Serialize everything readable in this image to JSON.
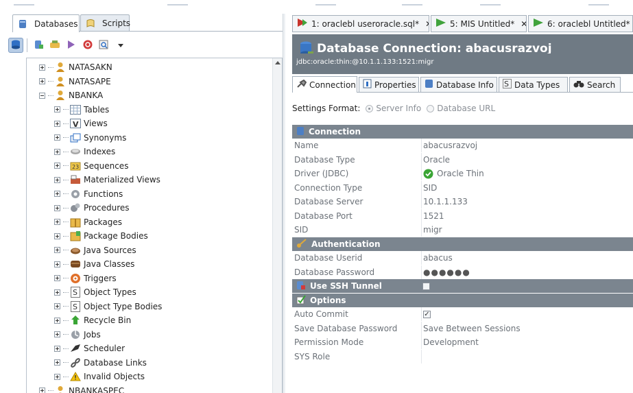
{
  "left_tabs": [
    {
      "label": "Databases",
      "active": true
    },
    {
      "label": "Scripts",
      "active": false
    }
  ],
  "tree": [
    {
      "label": "NATASAKN",
      "level": 0,
      "icon": "user-icon",
      "expanded": false
    },
    {
      "label": "NATASAPE",
      "level": 0,
      "icon": "user-icon",
      "expanded": false
    },
    {
      "label": "NBANKA",
      "level": 0,
      "icon": "user-icon",
      "expanded": true
    },
    {
      "label": "Tables",
      "level": 1,
      "icon": "tables-icon",
      "expanded": false
    },
    {
      "label": "Views",
      "level": 1,
      "icon": "views-icon",
      "expanded": false
    },
    {
      "label": "Synonyms",
      "level": 1,
      "icon": "synonyms-icon",
      "expanded": false
    },
    {
      "label": "Indexes",
      "level": 1,
      "icon": "indexes-icon",
      "expanded": false
    },
    {
      "label": "Sequences",
      "level": 1,
      "icon": "sequences-icon",
      "expanded": false
    },
    {
      "label": "Materialized Views",
      "level": 1,
      "icon": "materialized-views-icon",
      "expanded": false
    },
    {
      "label": "Functions",
      "level": 1,
      "icon": "functions-icon",
      "expanded": false
    },
    {
      "label": "Procedures",
      "level": 1,
      "icon": "procedures-icon",
      "expanded": false
    },
    {
      "label": "Packages",
      "level": 1,
      "icon": "packages-icon",
      "expanded": false
    },
    {
      "label": "Package Bodies",
      "level": 1,
      "icon": "package-bodies-icon",
      "expanded": false
    },
    {
      "label": "Java Sources",
      "level": 1,
      "icon": "java-sources-icon",
      "expanded": false
    },
    {
      "label": "Java Classes",
      "level": 1,
      "icon": "java-classes-icon",
      "expanded": false
    },
    {
      "label": "Triggers",
      "level": 1,
      "icon": "triggers-icon",
      "expanded": false
    },
    {
      "label": "Object Types",
      "level": 1,
      "icon": "object-types-icon",
      "expanded": false
    },
    {
      "label": "Object Type Bodies",
      "level": 1,
      "icon": "object-type-bodies-icon",
      "expanded": false
    },
    {
      "label": "Recycle Bin",
      "level": 1,
      "icon": "recycle-bin-icon",
      "expanded": false
    },
    {
      "label": "Jobs",
      "level": 1,
      "icon": "jobs-icon",
      "expanded": false
    },
    {
      "label": "Scheduler",
      "level": 1,
      "icon": "scheduler-icon",
      "expanded": false
    },
    {
      "label": "Database Links",
      "level": 1,
      "icon": "database-links-icon",
      "expanded": false
    },
    {
      "label": "Invalid Objects",
      "level": 1,
      "icon": "invalid-objects-icon",
      "expanded": false
    },
    {
      "label": "NBANKASPEC",
      "level": 0,
      "icon": "user-icon",
      "expanded": false
    }
  ],
  "editor_tabs": [
    {
      "label": "1: oraclebl useroracle.sql*",
      "closable": true
    },
    {
      "label": "5: MIS Untitled*",
      "closable": true
    },
    {
      "label": "6: oraclebl Untitled*",
      "closable": false
    }
  ],
  "connection": {
    "title": "Database Connection: abacusrazvoj",
    "url": "jdbc:oracle:thin:@10.1.1.133:1521:migr"
  },
  "detail_tabs": [
    "Connection",
    "Properties",
    "Database Info",
    "Data Types",
    "Search"
  ],
  "settings": {
    "label": "Settings Format:",
    "option1": "Server Info",
    "option2": "Database URL"
  },
  "sections": {
    "connection": "Connection",
    "authentication": "Authentication",
    "ssh": "Use SSH Tunnel",
    "options": "Options"
  },
  "conn_props": [
    {
      "key": "Name",
      "value": "abacusrazvoj"
    },
    {
      "key": "Database Type",
      "value": "Oracle"
    },
    {
      "key": "Driver (JDBC)",
      "value": "Oracle Thin"
    },
    {
      "key": "Connection Type",
      "value": "SID"
    },
    {
      "key": "Database Server",
      "value": "10.1.1.133"
    },
    {
      "key": "Database Port",
      "value": "1521"
    },
    {
      "key": "SID",
      "value": "migr"
    }
  ],
  "auth_props": [
    {
      "key": "Database Userid",
      "value": "abacus"
    },
    {
      "key": "Database Password",
      "value": "●●●●●●"
    }
  ],
  "option_props": [
    {
      "key": "Auto Commit",
      "value": ""
    },
    {
      "key": "Save Database Password",
      "value": "Save Between Sessions"
    },
    {
      "key": "Permission Mode",
      "value": "Development"
    },
    {
      "key": "SYS Role",
      "value": ""
    }
  ],
  "colors": {
    "header_bg": "#6f7a84",
    "section_bg": "#7b858f",
    "accent": "#2f7fd6",
    "ok_green": "#3aa535"
  }
}
